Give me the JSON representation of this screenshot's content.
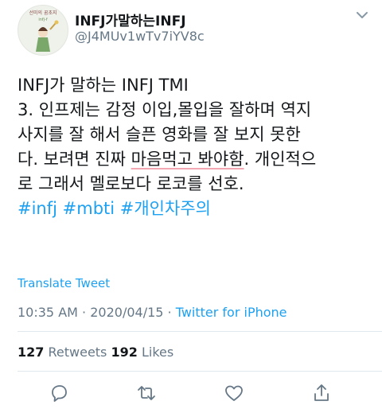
{
  "user": {
    "display_name": "INFJ가말하는INFJ",
    "handle": "@J4MUv1wTv7iYV8c",
    "avatar_text": "선미의 꿈초지",
    "avatar_sub": "infj-f"
  },
  "tweet": {
    "line1": "INFJ가 말하는 INFJ TMI",
    "line2": "3. 인프제는 감정 이입,몰입을 잘하며 역지",
    "line3": "사지를 잘 해서 슬픈 영화를 잘 보지 못한",
    "line4_pre": "다. 보려면 진짜 ",
    "line4_hl": "마음먹고 봐야함",
    "line4_post": ". 개인적으",
    "line5": "로 그래서 멜로보다 로코를 선호.",
    "hashtags": "#infj #mbti #개인차주의"
  },
  "translate_label": "Translate Tweet",
  "meta": {
    "time": "10:35 AM",
    "separator": " · ",
    "date": "2020/04/15",
    "separator2": " · ",
    "source": "Twitter for iPhone"
  },
  "stats": {
    "retweets_count": "127",
    "retweets_label": " Retweets  ",
    "likes_count": "192",
    "likes_label": " Likes"
  },
  "icons": [
    "chevron-down-icon",
    "reply-icon",
    "retweet-icon",
    "like-icon",
    "share-icon"
  ],
  "colors": {
    "link": "#1da1f2",
    "muted": "#657786",
    "text": "#14171a",
    "highlight_underline": "#f2a7b3"
  }
}
